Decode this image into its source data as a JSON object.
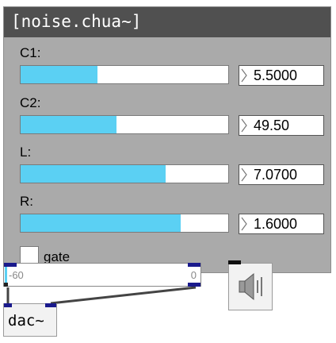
{
  "title": "[noise.chua~]",
  "params": [
    {
      "label": "C1:",
      "value": "5.5000",
      "level": 0.37
    },
    {
      "label": "C2:",
      "value": "49.50",
      "level": 0.46
    },
    {
      "label": "L:",
      "value": "7.0700",
      "level": 0.7
    },
    {
      "label": "R:",
      "value": "1.6000",
      "level": 0.77
    }
  ],
  "gate": {
    "label": "gate"
  },
  "gain": {
    "min": "-60",
    "max": "0",
    "level": 0.0
  },
  "dac": {
    "label": "dac~"
  },
  "colors": {
    "title_bg": "#505050",
    "panel_bg": "#aaaaaa",
    "slider_fill": "#5bd0f3",
    "inlet": "#1a1a8c"
  },
  "icons": {
    "speaker": "speaker-icon"
  }
}
